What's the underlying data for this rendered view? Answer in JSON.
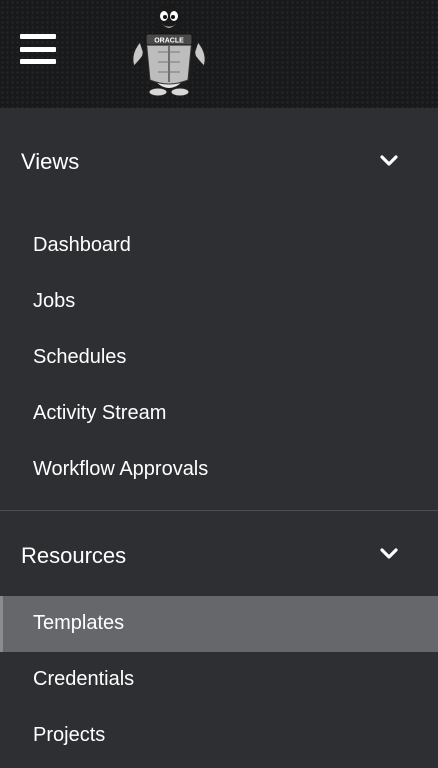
{
  "masthead": {
    "menu_icon": "hamburger-menu-icon",
    "logo_icon": "oracle-tux-penguin-logo",
    "logo_text": "ORACLE"
  },
  "nav": {
    "groups": [
      {
        "title": "Views",
        "toggle_icon": "chevron-down-icon",
        "items": [
          {
            "label": "Dashboard"
          },
          {
            "label": "Jobs"
          },
          {
            "label": "Schedules"
          },
          {
            "label": "Activity Stream"
          },
          {
            "label": "Workflow Approvals"
          }
        ]
      },
      {
        "title": "Resources",
        "toggle_icon": "chevron-down-icon",
        "items": [
          {
            "label": "Templates",
            "active": true
          },
          {
            "label": "Credentials"
          },
          {
            "label": "Projects"
          }
        ]
      }
    ]
  },
  "colors": {
    "masthead_bg": "#17191b",
    "nav_bg": "#2e2f33",
    "active_item_bg": "#66676b",
    "text": "#ffffff"
  }
}
